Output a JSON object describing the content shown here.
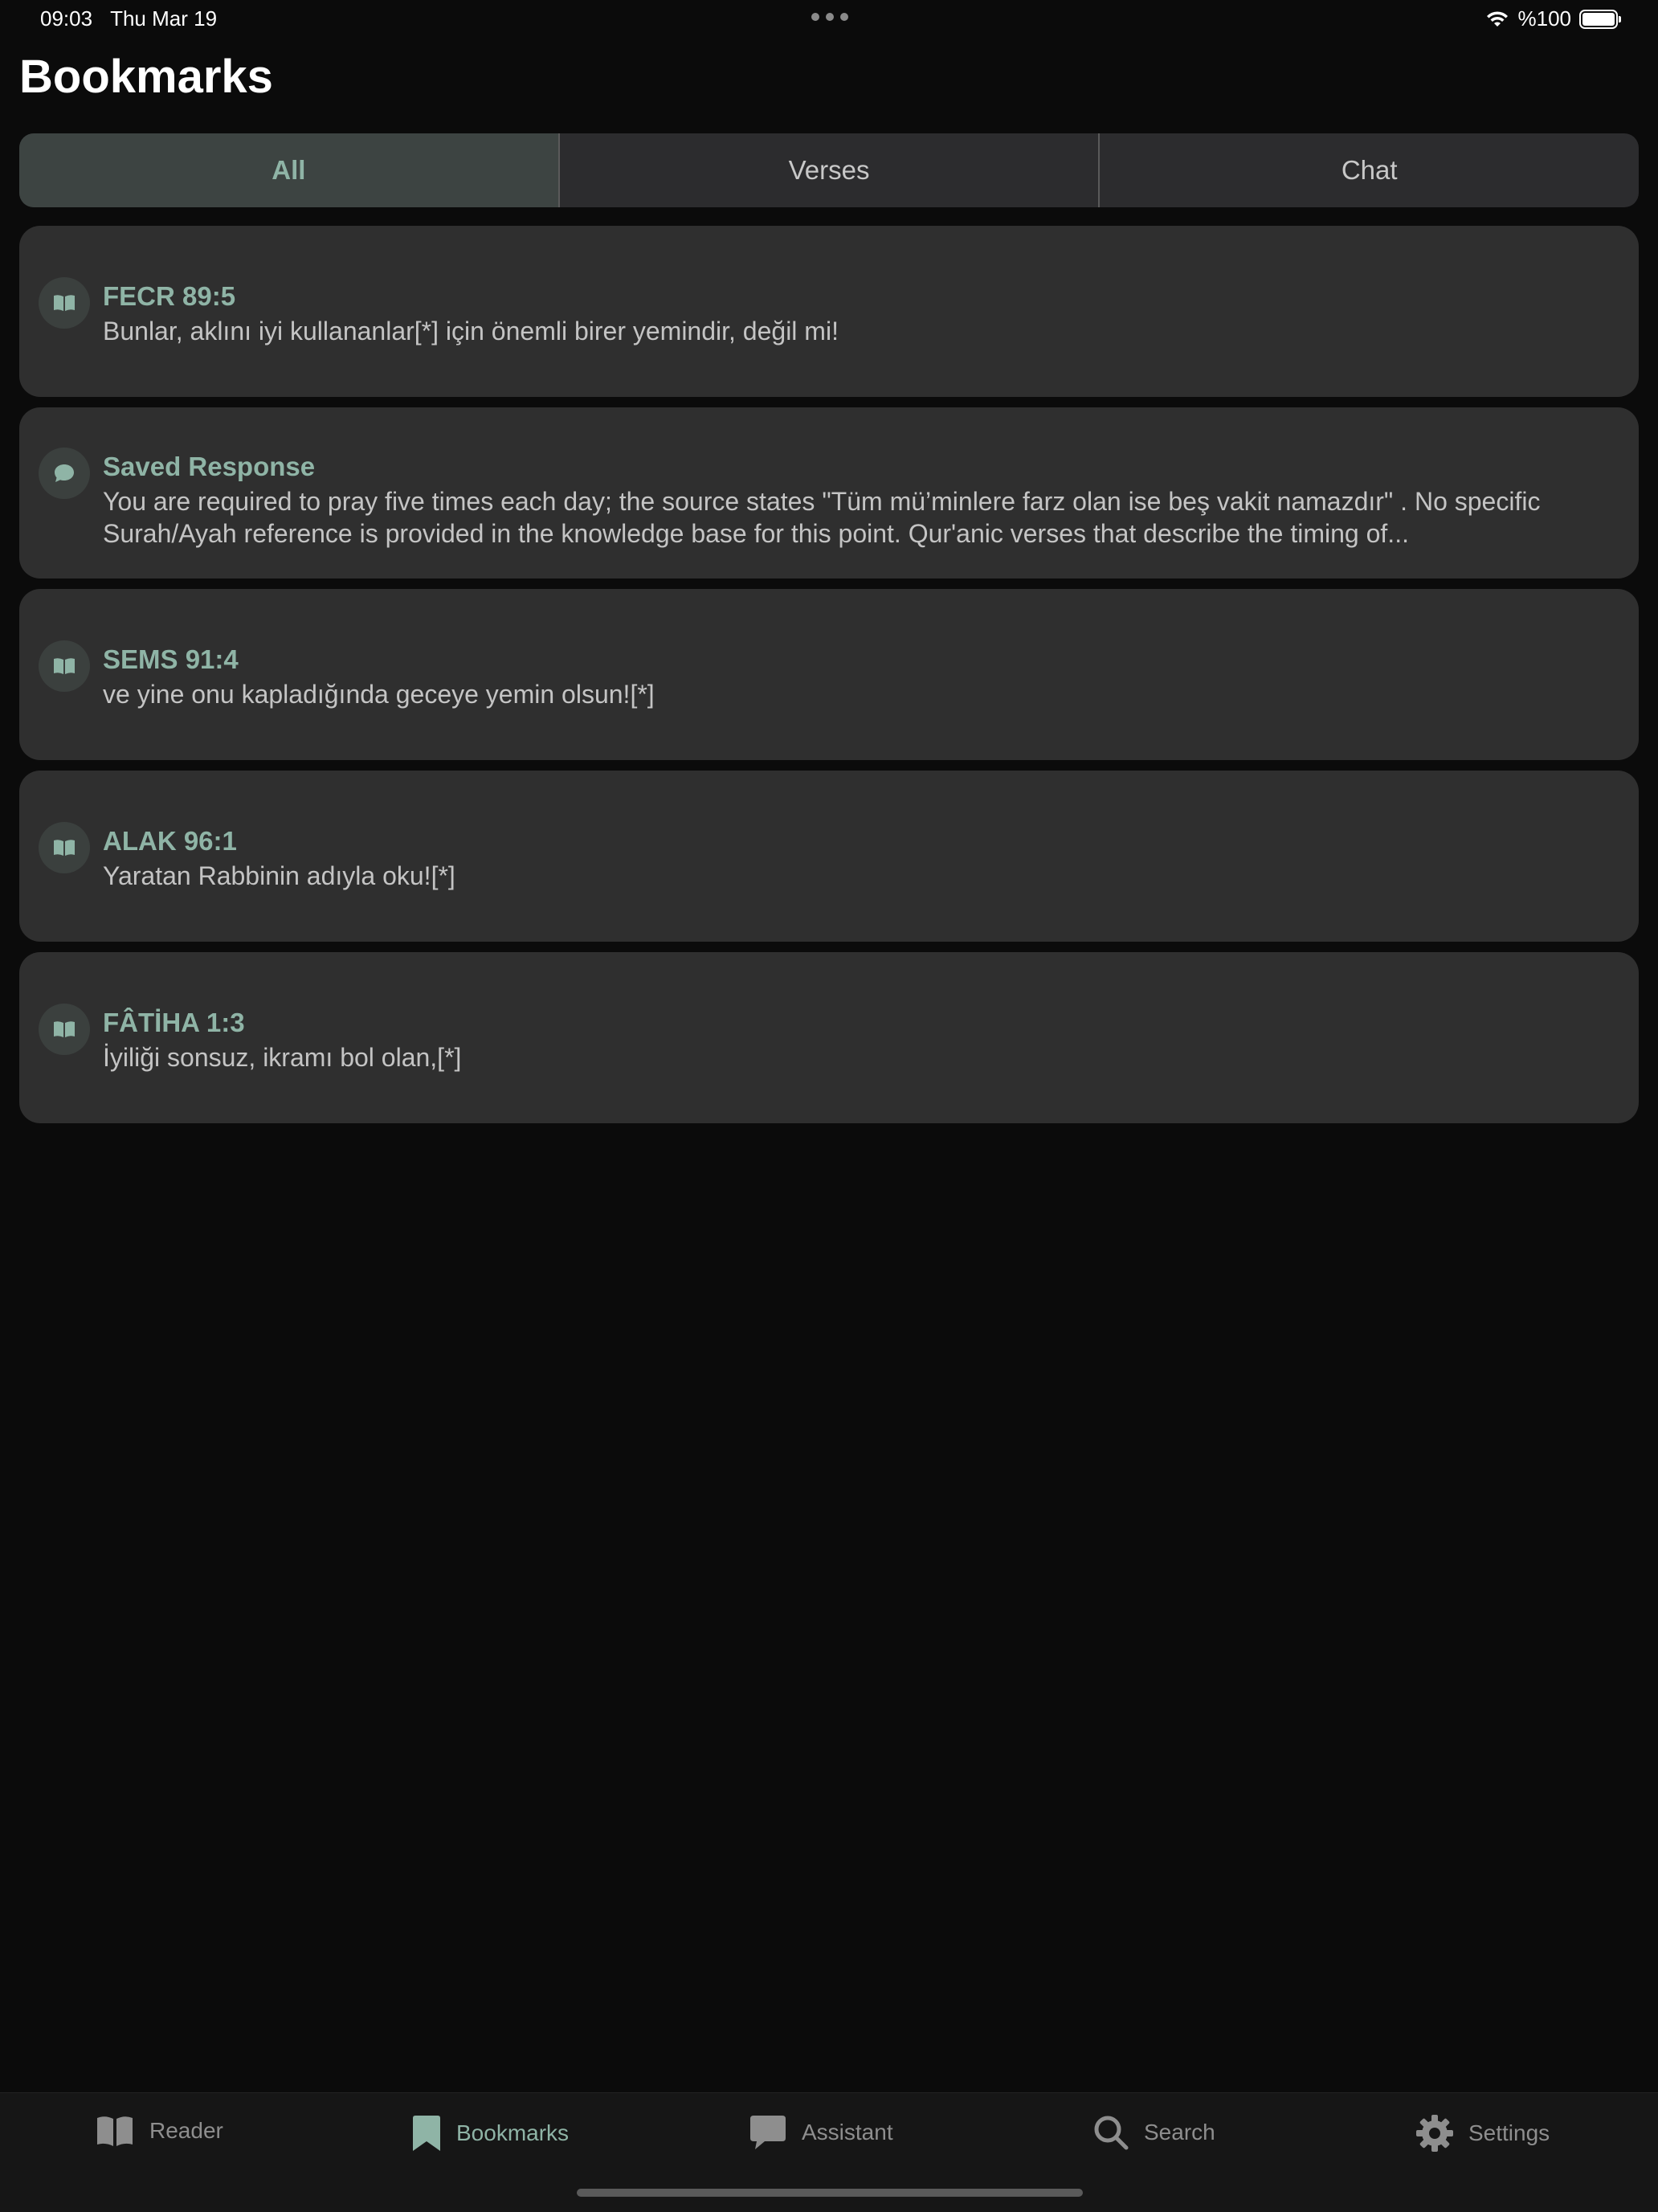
{
  "status_bar": {
    "time": "09:03",
    "date": "Thu Mar 19",
    "battery": "%100"
  },
  "page": {
    "title": "Bookmarks"
  },
  "filter_tabs": [
    {
      "label": "All",
      "active": true
    },
    {
      "label": "Verses",
      "active": false
    },
    {
      "label": "Chat",
      "active": false
    }
  ],
  "bookmarks": [
    {
      "icon": "book-icon",
      "title": "FECR 89:5",
      "text": "Bunlar, aklını iyi kullananlar[*] için önemli birer yemindir, değil mi!"
    },
    {
      "icon": "chat-bubble-icon",
      "title": "Saved Response",
      "text": "You are required to pray five times each day; the source states \"Tüm mü’minlere farz olan ise beş vakit namazdır\" . No specific Surah/Ayah reference is provided in the knowledge base for this point. Qur'anic verses that describe the timing of..."
    },
    {
      "icon": "book-icon",
      "title": "SEMS 91:4",
      "text": "ve yine onu kapladığında geceye yemin olsun![*]"
    },
    {
      "icon": "book-icon",
      "title": "ALAK 96:1",
      "text": "Yaratan Rabbinin adıyla oku![*]"
    },
    {
      "icon": "book-icon",
      "title": "FÂTİHA 1:3",
      "text": "İyiliği sonsuz, ikramı bol olan,[*]"
    }
  ],
  "tab_bar": {
    "items": [
      {
        "label": "Reader",
        "icon": "book-open-icon",
        "active": false
      },
      {
        "label": "Bookmarks",
        "icon": "bookmark-icon",
        "active": true
      },
      {
        "label": "Assistant",
        "icon": "chat-bubble-icon",
        "active": false
      },
      {
        "label": "Search",
        "icon": "magnifier-icon",
        "active": false
      },
      {
        "label": "Settings",
        "icon": "gear-icon",
        "active": false
      }
    ]
  },
  "colors": {
    "background": "#0b0b0b",
    "card": "#2f2f2f",
    "accent": "#8fb4a6",
    "inactive": "#8e8e8e"
  }
}
